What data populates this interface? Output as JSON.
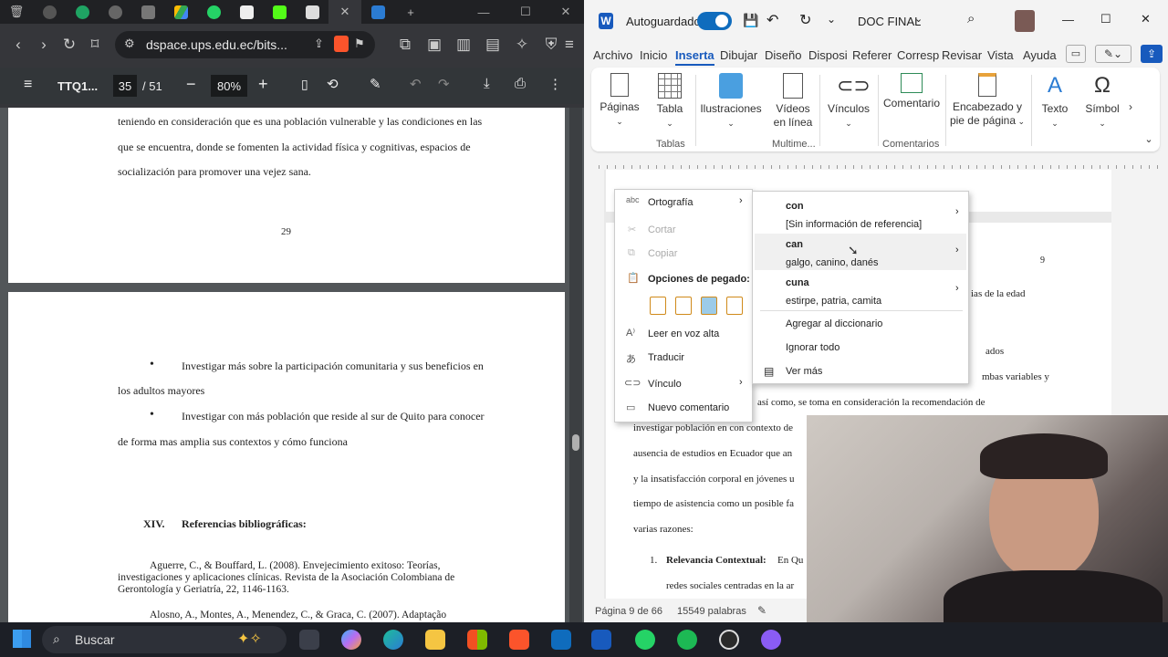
{
  "browser": {
    "tab_icons": [
      "trash-icon",
      "tab-icon-2",
      "tab-icon-3",
      "tab-icon-4",
      "tab-icon-5",
      "google-drive-icon",
      "whatsapp-icon",
      "tab-icon-8",
      "kick-icon",
      "tab-icon-10",
      "close-icon",
      "tab-icon-12"
    ],
    "url": "dspace.ups.edu.ec/bits...",
    "pdf": {
      "title": "TTQ1...",
      "page_current": "35",
      "page_total": "/ 51",
      "zoom": "80%"
    },
    "page1": {
      "line1": "teniendo en consideración que es una población vulnerable y las condiciones en las",
      "line2": "que se encuentra, donde se fomenten la actividad física y cognitivas, espacios de",
      "line3": "socialización para promover una vejez sana.",
      "page_number": "29"
    },
    "page2": {
      "bullet1a": "Investigar más sobre la participación comunitaria y sus beneficios en",
      "bullet1b": "los adultos mayores",
      "bullet2a": "Investigar con más población que reside al sur de Quito para conocer",
      "bullet2b": "de forma mas amplia sus contextos y cómo funciona",
      "section_num": "XIV.",
      "section_title": "Referencias bibliográficas:",
      "ref1a": "Aguerre, C., & Bouffard, L. (2008). Envejecimiento exitoso: Teorías,",
      "ref1b": "investigaciones y aplicaciones clínicas. Revista de la Asociación Colombiana de",
      "ref1c": "Gerontología y Geriatría, 22, 1146-1163.",
      "ref2a": "Alosno, A., Montes, A., Menendez, C., & Graca, C. (2007). Adaptação"
    }
  },
  "word": {
    "autosave_label": "Autoguardado",
    "doc_title": "DOC FINAL",
    "tabs": [
      "Archivo",
      "Inicio",
      "Inserta",
      "Dibujar",
      "Diseño",
      "Disposi",
      "Referer",
      "Corresp",
      "Revisar",
      "Vista",
      "Ayuda"
    ],
    "ribbon": {
      "paginas": "Páginas",
      "tabla": "Tabla",
      "ilustraciones": "Ilustraciones",
      "videos1": "Vídeos",
      "videos2": "en línea",
      "vinculos": "Vínculos",
      "comentario": "Comentario",
      "encabezado1": "Encabezado y",
      "encabezado2": "pie de página",
      "texto": "Texto",
      "simbolos": "Símbol",
      "group_tablas": "Tablas",
      "group_multimedia": "Multime...",
      "group_comentarios": "Comentarios"
    },
    "doc": {
      "page_number": "9",
      "frag1": "ias de la edad",
      "frag2": "ados",
      "frag3": "mbas variables y",
      "line4": "así como, se toma en consideración la recomendación de",
      "line5": "investigar población en con contexto de",
      "line6": "ausencia de estudios en Ecuador que an",
      "line7": "y la insatisfacción corporal en jóvenes u",
      "line8": "tiempo de asistencia como un posible fa",
      "line9": "varias razones:",
      "item_num": "1.",
      "item_title": "Relevancia Contextual:",
      "item_text": "En Qu",
      "line11": "redes sociales centradas en la ar"
    },
    "status": {
      "page": "Página 9 de 66",
      "words": "15549 palabras"
    }
  },
  "context_menu": {
    "ortografia": "Ortografía",
    "cortar": "Cortar",
    "copiar": "Copiar",
    "opciones_pegado": "Opciones de pegado:",
    "leer": "Leer en voz alta",
    "traducir": "Traducir",
    "vinculo": "Vínculo",
    "nuevo_comentario": "Nuevo comentario"
  },
  "spelling_submenu": {
    "s1_word": "con",
    "s1_desc": "[Sin información de referencia]",
    "s2_word": "can",
    "s2_desc": "galgo, canino, danés",
    "s3_word": "cuna",
    "s3_desc": "estirpe, patria, camita",
    "agregar": "Agregar al diccionario",
    "ignorar": "Ignorar todo",
    "ver_mas": "Ver más"
  },
  "taskbar": {
    "search": "Buscar"
  },
  "colors": {
    "word_blue": "#185abd",
    "accent": "#0f6cbd"
  }
}
